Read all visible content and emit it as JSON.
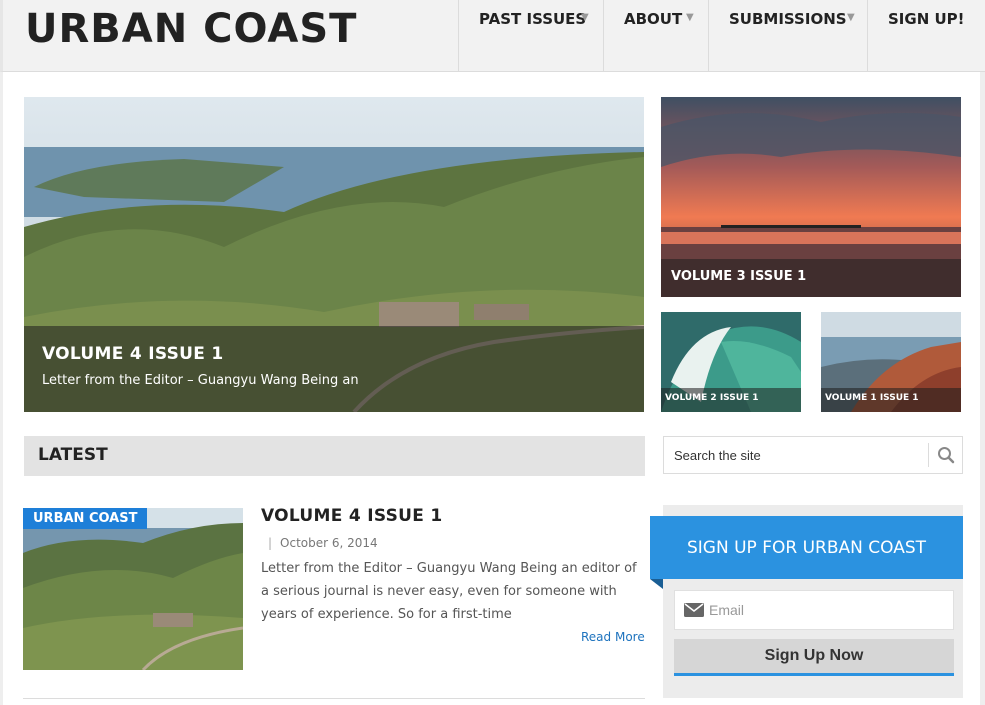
{
  "site": {
    "logo": "URBAN COAST"
  },
  "nav": {
    "items": [
      {
        "label": "PAST ISSUES",
        "has_dropdown": true
      },
      {
        "label": "ABOUT",
        "has_dropdown": true
      },
      {
        "label": "SUBMISSIONS",
        "has_dropdown": true
      },
      {
        "label": "SIGN UP!",
        "has_dropdown": false
      }
    ]
  },
  "hero": {
    "main": {
      "title": "VOLUME 4 ISSUE 1",
      "subtitle": "Letter from the Editor – Guangyu Wang Being an"
    },
    "v3": {
      "title": "VOLUME 3 ISSUE 1"
    },
    "v2": {
      "title": "VOLUME 2 ISSUE 1"
    },
    "v1": {
      "title": "VOLUME 1 ISSUE 1"
    }
  },
  "latest": {
    "heading": "LATEST"
  },
  "search": {
    "placeholder": "Search the site"
  },
  "article": {
    "category": "URBAN COAST",
    "title": "VOLUME 4 ISSUE 1",
    "separator": "|",
    "date": "October 6, 2014",
    "excerpt": "Letter from the Editor – Guangyu Wang Being an editor of a serious journal is never easy, even for someone with years of experience. So for a first-time",
    "read_more": "Read More"
  },
  "signup": {
    "heading": "SIGN UP FOR URBAN COAST",
    "email_placeholder": "Email",
    "button": "Sign Up Now"
  },
  "colors": {
    "accent": "#2b92e0",
    "badge": "#1e7fd8",
    "link": "#1e73be"
  },
  "icons": {
    "dropdown": "chevron-down-icon",
    "search": "search-icon",
    "email": "envelope-icon"
  }
}
